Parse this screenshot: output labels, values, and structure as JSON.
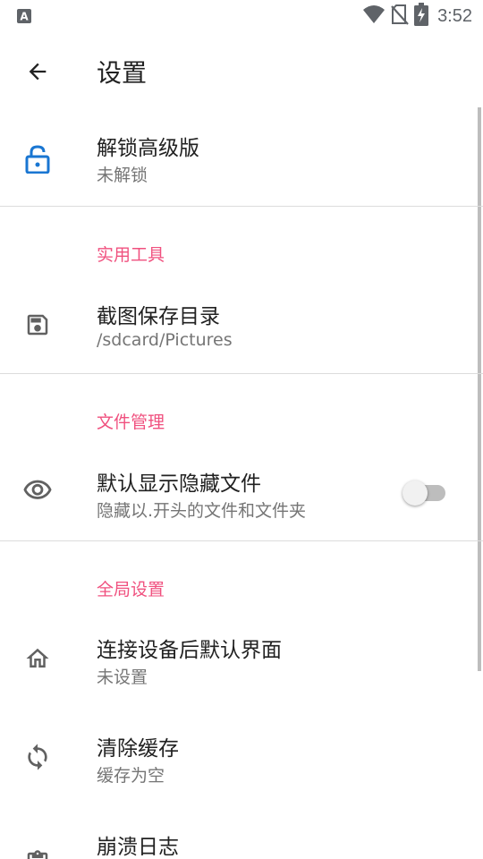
{
  "statusbar": {
    "time": "3:52",
    "left_icon": "a-notification-icon",
    "icons": [
      "wifi-icon",
      "no-sim-icon",
      "battery-charging-icon"
    ]
  },
  "toolbar": {
    "back_icon": "arrow-back-icon",
    "title": "设置"
  },
  "colors": {
    "accent": "#f0517f",
    "unlock_icon": "#1976d2",
    "icon_gray": "#616161",
    "summary": "#757575"
  },
  "unlock": {
    "title": "解锁高级版",
    "summary": "未解锁",
    "icon": "lock-open-icon"
  },
  "tools": {
    "header": "实用工具",
    "screenshot_dir": {
      "title": "截图保存目录",
      "summary": "/sdcard/Pictures",
      "icon": "save-icon"
    }
  },
  "file_mgmt": {
    "header": "文件管理",
    "show_hidden": {
      "title": "默认显示隐藏文件",
      "summary": "隐藏以.开头的文件和文件夹",
      "icon": "eye-icon",
      "enabled": false
    }
  },
  "global": {
    "header": "全局设置",
    "default_view": {
      "title": "连接设备后默认界面",
      "summary": "未设置",
      "icon": "home-icon"
    },
    "clear_cache": {
      "title": "清除缓存",
      "summary": "缓存为空",
      "icon": "sync-icon"
    },
    "crash_log": {
      "title": "崩溃日志",
      "icon": "clipboard-icon"
    }
  }
}
